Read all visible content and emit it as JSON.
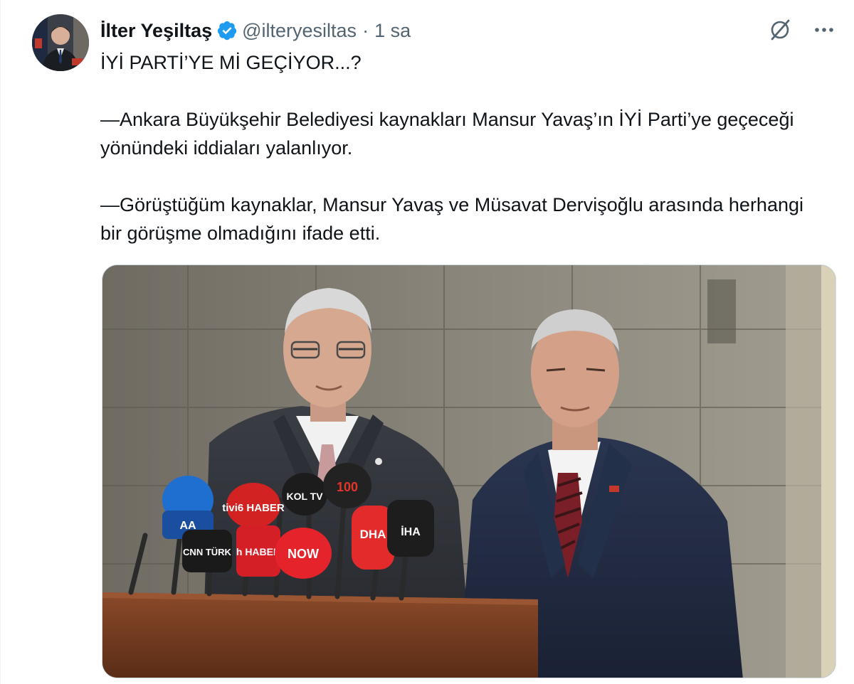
{
  "tweet": {
    "author": {
      "display_name": "İlter Yeşiltaş",
      "handle": "@ilteryesiltas",
      "verified": true,
      "verified_color": "#1d9bf0"
    },
    "separator": "·",
    "time": "1 sa",
    "text_paragraphs": [
      "İYİ PARTİ’YE Mİ GEÇİYOR...?",
      "—Ankara Büyükşehir Belediyesi kaynakları Mansur Yavaş’ın İYİ Parti’ye geçeceği yönündeki iddiaları yalanlıyor.",
      "—Görüştüğüm kaynaklar, Mansur Yavaş ve Müsavat Dervişoğlu arasında herhangi bir görüşme olmadığını ifade etti."
    ],
    "microphone_labels": [
      "AA",
      "tivi6 HABER",
      "KOL TV",
      "100",
      "CNN TÜRK",
      "h HABER",
      "NOW",
      "DHA",
      "İHA"
    ],
    "icons": {
      "grok": "grok-icon",
      "more": "more-icon",
      "verified": "verified-badge-icon"
    }
  }
}
